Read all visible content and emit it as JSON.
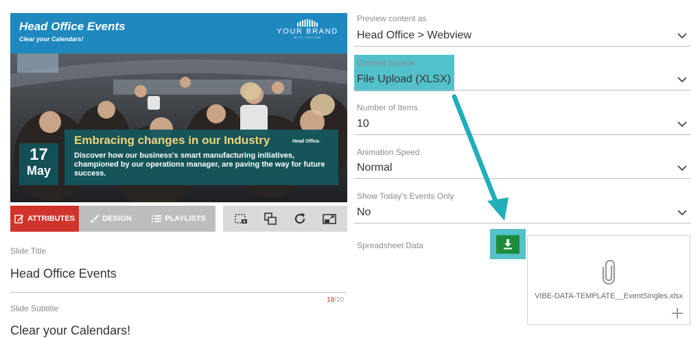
{
  "preview": {
    "title": "Head Office Events",
    "subtitle": "Clear your Calendars!",
    "brand_name": "YOUR BRAND",
    "brand_tagline": "WITH TAGLINE",
    "date_day": "17",
    "date_month": "May",
    "headline": "Embracing changes in our Industry",
    "headline_tail": "Head Office.",
    "body": "Discover how our business's smart manufacturing initiatives, championed by our operations manager, are paving the way for future success."
  },
  "tabs": [
    {
      "label": "ATTRIBUTES",
      "icon": "edit-icon",
      "active": true
    },
    {
      "label": "DESIGN",
      "icon": "brush-icon",
      "active": false
    },
    {
      "label": "PLAYLISTS",
      "icon": "list-icon",
      "active": false
    }
  ],
  "toolbar_icons": [
    "screenshot-icon",
    "layers-icon",
    "refresh-icon",
    "fullscreen-icon"
  ],
  "form_left": {
    "slide_title_label": "Slide Title",
    "slide_title_value": "Head Office Events",
    "slide_title_count": "18",
    "slide_title_max": "/10",
    "slide_subtitle_label": "Slide Subtitle",
    "slide_subtitle_value": "Clear your Calendars!"
  },
  "form_right": {
    "preview_as_label": "Preview content as",
    "preview_as_value": "Head Office > Webview",
    "content_source_label": "Content Source",
    "content_source_value": "File Upload (XLSX)",
    "items_label": "Number of Items",
    "items_value": "10",
    "speed_label": "Animation Speed",
    "speed_value": "Normal",
    "today_label": "Show Today's Events Only",
    "today_value": "No",
    "spreadsheet_label": "Spreadsheet Data",
    "spreadsheet_file": "VIBE-DATA-TEMPLATE__EventSingles.xlsx"
  },
  "colors": {
    "accent_red": "#d0342c",
    "highlight_teal": "#53c1cb",
    "download_green": "#1e8b3a",
    "header_blue": "#1f88bf"
  }
}
